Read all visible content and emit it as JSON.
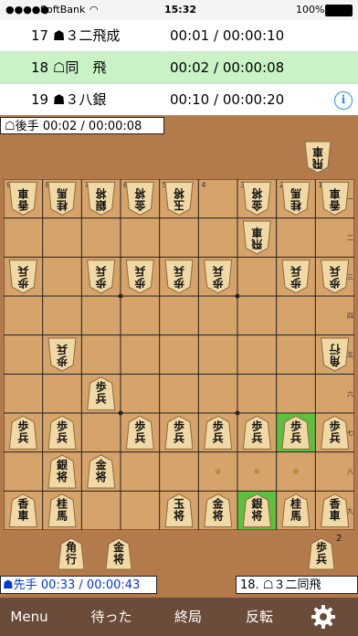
{
  "status_bar": {
    "carrier": "SoftBank",
    "time": "15:32",
    "battery": "100%"
  },
  "moves": [
    {
      "number": "17",
      "side_icon": "sente",
      "notation": "３二飛成",
      "times": "00:01 / 00:00:10",
      "selected": false
    },
    {
      "number": "18",
      "side_icon": "gote",
      "notation": "同　飛",
      "times": "00:02 / 00:00:08",
      "selected": true
    },
    {
      "number": "19",
      "side_icon": "sente",
      "notation": "３八銀",
      "times": "00:10 / 00:00:20",
      "selected": false
    }
  ],
  "info_button": "i",
  "clock_gote": {
    "label": "後手",
    "times": "00:02 / 00:00:08"
  },
  "clock_sente": {
    "label": "先手",
    "times": "00:33 / 00:00:43"
  },
  "last_move": {
    "number": "18.",
    "notation": "３二同飛"
  },
  "board": {
    "files": [
      "9",
      "8",
      "7",
      "6",
      "5",
      "4",
      "3",
      "2",
      "1"
    ],
    "ranks": [
      "一",
      "二",
      "三",
      "四",
      "五",
      "六",
      "七",
      "八",
      "九"
    ],
    "highlight_squares": [
      [
        2,
        7
      ],
      [
        3,
        9
      ]
    ],
    "pieces": [
      {
        "f": 9,
        "r": 1,
        "t": "香車",
        "o": "gote"
      },
      {
        "f": 8,
        "r": 1,
        "t": "桂馬",
        "o": "gote"
      },
      {
        "f": 7,
        "r": 1,
        "t": "銀将",
        "o": "gote"
      },
      {
        "f": 6,
        "r": 1,
        "t": "金将",
        "o": "gote"
      },
      {
        "f": 5,
        "r": 1,
        "t": "玉将",
        "o": "gote"
      },
      {
        "f": 3,
        "r": 1,
        "t": "金将",
        "o": "gote"
      },
      {
        "f": 2,
        "r": 1,
        "t": "桂馬",
        "o": "gote"
      },
      {
        "f": 1,
        "r": 1,
        "t": "香車",
        "o": "gote"
      },
      {
        "f": 3,
        "r": 2,
        "t": "飛車",
        "o": "gote"
      },
      {
        "f": 9,
        "r": 3,
        "t": "歩兵",
        "o": "gote"
      },
      {
        "f": 7,
        "r": 3,
        "t": "歩兵",
        "o": "gote"
      },
      {
        "f": 6,
        "r": 3,
        "t": "歩兵",
        "o": "gote"
      },
      {
        "f": 5,
        "r": 3,
        "t": "歩兵",
        "o": "gote"
      },
      {
        "f": 4,
        "r": 3,
        "t": "歩兵",
        "o": "gote"
      },
      {
        "f": 2,
        "r": 3,
        "t": "歩兵",
        "o": "gote"
      },
      {
        "f": 1,
        "r": 3,
        "t": "歩兵",
        "o": "gote"
      },
      {
        "f": 8,
        "r": 5,
        "t": "歩兵",
        "o": "gote"
      },
      {
        "f": 1,
        "r": 5,
        "t": "角行",
        "o": "gote"
      },
      {
        "f": 7,
        "r": 6,
        "t": "歩兵",
        "o": "sente"
      },
      {
        "f": 9,
        "r": 7,
        "t": "歩兵",
        "o": "sente"
      },
      {
        "f": 8,
        "r": 7,
        "t": "歩兵",
        "o": "sente"
      },
      {
        "f": 6,
        "r": 7,
        "t": "歩兵",
        "o": "sente"
      },
      {
        "f": 5,
        "r": 7,
        "t": "歩兵",
        "o": "sente"
      },
      {
        "f": 4,
        "r": 7,
        "t": "歩兵",
        "o": "sente"
      },
      {
        "f": 3,
        "r": 7,
        "t": "歩兵",
        "o": "sente"
      },
      {
        "f": 2,
        "r": 7,
        "t": "歩兵",
        "o": "sente"
      },
      {
        "f": 1,
        "r": 7,
        "t": "歩兵",
        "o": "sente"
      },
      {
        "f": 8,
        "r": 8,
        "t": "銀将",
        "o": "sente"
      },
      {
        "f": 7,
        "r": 8,
        "t": "金将",
        "o": "sente"
      },
      {
        "f": 9,
        "r": 9,
        "t": "香車",
        "o": "sente"
      },
      {
        "f": 8,
        "r": 9,
        "t": "桂馬",
        "o": "sente"
      },
      {
        "f": 5,
        "r": 9,
        "t": "玉将",
        "o": "sente"
      },
      {
        "f": 4,
        "r": 9,
        "t": "金将",
        "o": "sente"
      },
      {
        "f": 3,
        "r": 9,
        "t": "銀将",
        "o": "sente"
      },
      {
        "f": 2,
        "r": 9,
        "t": "桂馬",
        "o": "sente"
      },
      {
        "f": 1,
        "r": 9,
        "t": "香車",
        "o": "sente"
      }
    ]
  },
  "hand_gote": [
    {
      "t": "飛車"
    }
  ],
  "hand_sente": [
    {
      "t": "角行"
    },
    {
      "t": "金将"
    },
    {
      "t": "歩兵",
      "count": "2"
    }
  ],
  "toolbar": {
    "menu": "Menu",
    "wait": "待った",
    "end": "終局",
    "flip": "反転",
    "settings_icon": "gear-icon"
  },
  "colors": {
    "selected_row": "#c9f3c7",
    "highlight_square": "#5fbf3f",
    "sente_text": "#0037e0",
    "toolbar": "#6b4b3a"
  }
}
